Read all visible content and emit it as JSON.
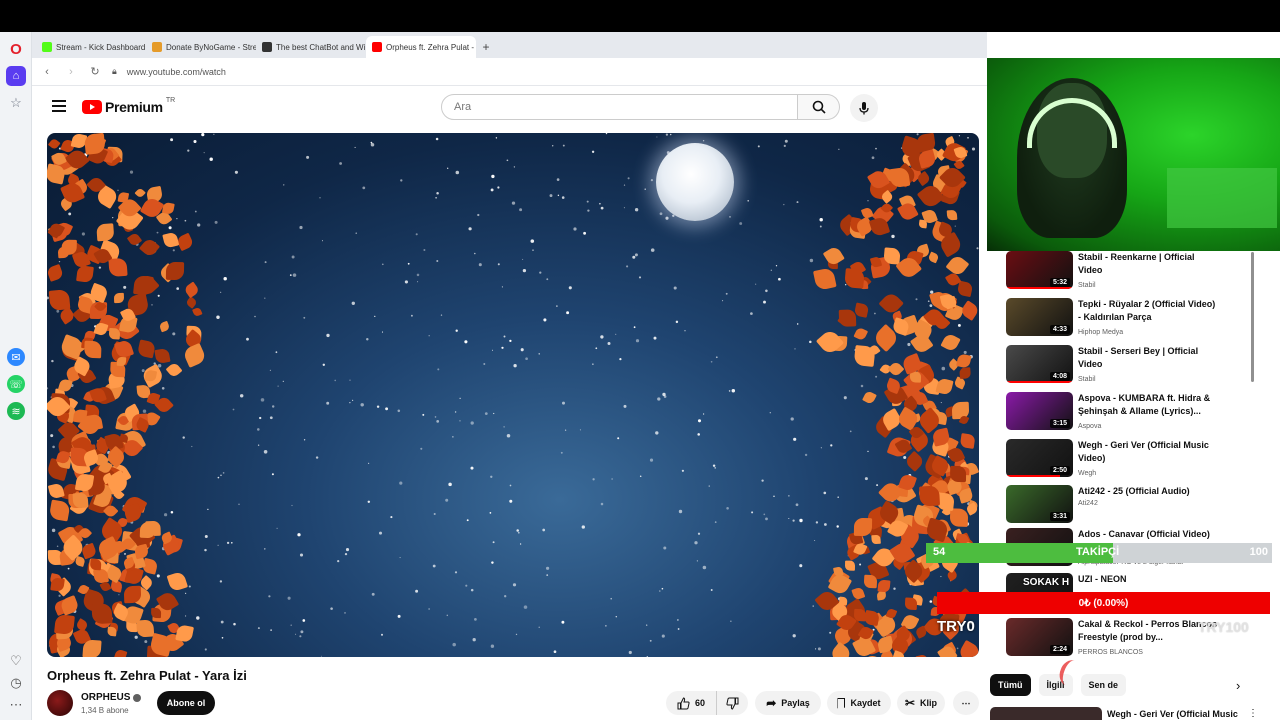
{
  "browser": {
    "tabs": [
      {
        "label": "Stream - Kick Dashboard",
        "color": "#53fc18"
      },
      {
        "label": "Donate ByNoGame - Strea",
        "color": "#e59b2a"
      },
      {
        "label": "The best ChatBot and Wi",
        "color": "#333333"
      },
      {
        "label": "Orpheus ft. Zehra Pulat -",
        "color": "#ff0000"
      }
    ],
    "new_tab": "+",
    "url": "www.youtube.com/watch"
  },
  "youtube": {
    "logo_text": "Premium",
    "region": "TR",
    "search_placeholder": "Ara"
  },
  "video": {
    "title": "Orpheus ft. Zehra Pulat - Yara İzi",
    "channel": "ORPHEUS",
    "subscribers": "1,34 B abone",
    "subscribe_label": "Abone ol",
    "likes": "60",
    "share_label": "Paylaş",
    "save_label": "Kaydet",
    "clip_label": "Klip"
  },
  "related": [
    {
      "title": "Stabil - Reenkarne | Official Video",
      "channel": "Stabil",
      "duration": "5:32",
      "color": "#6b0d12",
      "progress": 1.0
    },
    {
      "title": "Tepki - Rüyalar 2 (Official Video) - Kaldırılan Parça",
      "channel": "Hiphop Medya",
      "duration": "4:33",
      "color": "#5a4a2a",
      "progress": 0
    },
    {
      "title": "Stabil - Serseri Bey | Official Video",
      "channel": "Stabil",
      "duration": "4:08",
      "color": "#4a4a4a",
      "progress": 1.0
    },
    {
      "title": "Aspova - KUMBARA ft. Hidra & Şehinşah & Allame (Lyrics)...",
      "channel": "Aspova",
      "duration": "3:15",
      "color": "#8a1aa8",
      "progress": 0
    },
    {
      "title": "Wegh - Geri Ver (Official Music Video)",
      "channel": "Wegh",
      "duration": "2:50",
      "color": "#2a2a2a",
      "progress": 0.8
    },
    {
      "title": "Ati242 - 25 (Official Audio)",
      "channel": "Ati242",
      "duration": "3:31",
      "color": "#3a6a2a",
      "progress": 0
    },
    {
      "title": "Ados - Canavar (Official Video)",
      "channel": "AlphapalacePRO ve 2 diğer kanal",
      "duration": "",
      "color": "#3a2020",
      "progress": 0
    },
    {
      "title": "UZI - NEON",
      "channel": "",
      "duration": "",
      "color": "#202020",
      "progress": 0
    },
    {
      "title": "Cakal & Reckol - Perros Blancos Freestyle (prod by...",
      "channel": "PERROS BLANCOS",
      "duration": "2:24",
      "color": "#6a2a2a",
      "progress": 0
    }
  ],
  "overlay": {
    "followers_current": "54",
    "followers_label": "TAKİPÇİ",
    "followers_goal": "100",
    "followers_fraction": 0.54,
    "donation": "0₺ (0.00%)",
    "sokak": "SOKAK H",
    "try_left": "TRY0",
    "try_right": "TRY100"
  },
  "chips": [
    "Tümü",
    "İlgili",
    "Sen de"
  ],
  "last_related": {
    "title": "Wegh - Geri Ver (Official Music"
  },
  "colors": {
    "accent": "#ff0000",
    "follow_green": "#4dbd3f",
    "donate_red": "#ee0000"
  }
}
